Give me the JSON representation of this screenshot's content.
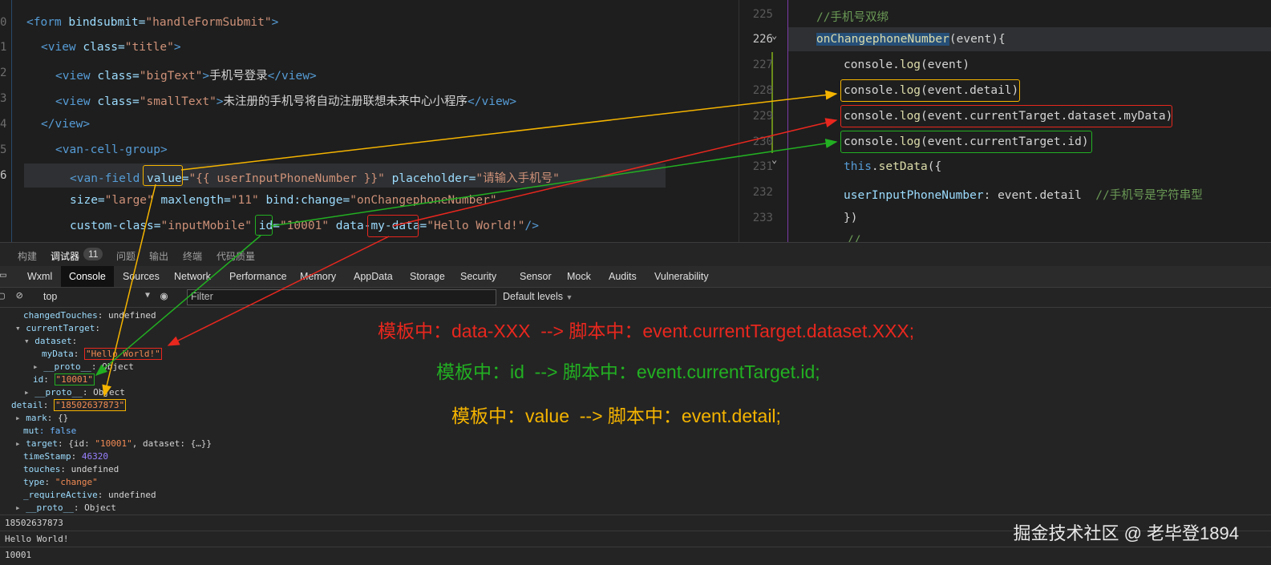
{
  "left_editor": {
    "line_numbers": [
      "0",
      "1",
      "2",
      "3",
      "4",
      "5",
      "6"
    ],
    "lines": {
      "l1_tag_open": "<form",
      "l1_attr": " bindsubmit=",
      "l1_val": "\"handleFormSubmit\"",
      "l1_close": ">",
      "l2_tag": "<view",
      "l2_attr": " class=",
      "l2_val": "\"title\"",
      "l2_close": ">",
      "l3_tag": "<view",
      "l3_attr": " class=",
      "l3_val": "\"bigText\"",
      "l3_close": ">",
      "l3_text": "手机号登录",
      "l3_end": "</view>",
      "l4_tag": "<view",
      "l4_attr": " class=",
      "l4_val": "\"smallText\"",
      "l4_close": ">",
      "l4_text": "未注册的手机号将自动注册联想未来中心小程序",
      "l4_end": "</view>",
      "l5": "</view>",
      "l6_tag": "<van-cell-group>",
      "l7_tag": "<van-field",
      "l7_attr1": "value",
      "l7_eq1": "=",
      "l7_val1": "\"{{ userInputPhoneNumber }}\"",
      "l7_attr2": " placeholder=",
      "l7_val2": "\"请输入手机号\"",
      "l8_attr1": "size=",
      "l8_val1": "\"large\"",
      "l8_attr2": " maxlength=",
      "l8_val2": "\"11\"",
      "l8_attr3": " bind:change=",
      "l8_val3": "\"onChangephoneNumber\"",
      "l9_attr1": "custom-class=",
      "l9_val1": "\"inputMobile\"",
      "l9_attr2": "id",
      "l9_eq2": "=",
      "l9_val2": "\"10001\"",
      "l9_attr3a": " data-",
      "l9_attr3b": "my-data",
      "l9_eq3": "=",
      "l9_val3": "\"Hello World!\"",
      "l9_close": "/>"
    }
  },
  "right_editor": {
    "line_numbers": [
      "225",
      "226",
      "227",
      "228",
      "229",
      "230",
      "231",
      "232",
      "233"
    ],
    "lines": {
      "r1": "//手机号双绑",
      "r2_fn": "onChangephoneNumber",
      "r2_rest": "(event){",
      "r3_a": "console.",
      "r3_fn": "log",
      "r3_b": "(event)",
      "r4_a": "console.",
      "r4_fn": "log",
      "r4_b": "(event.detail)",
      "r5_a": "console.",
      "r5_fn": "log",
      "r5_b": "(event.currentTarget.dataset.myData)",
      "r6_a": "console.",
      "r6_fn": "log",
      "r6_b": "(event.currentTarget.id)",
      "r7_kw": "this",
      "r7_b": ".",
      "r7_fn": "setData",
      "r7_c": "({",
      "r8_key": "userInputPhoneNumber",
      "r8_b": ": event.detail  ",
      "r8_cmt": "//手机号是字符串型",
      "r9": "})",
      "r10": "//"
    }
  },
  "panel_tabs": [
    "构建",
    "调试器",
    "11",
    "问题",
    "输出",
    "终端",
    "代码质量"
  ],
  "dev_tabs": [
    "Wxml",
    "Console",
    "Sources",
    "Network",
    "Performance",
    "Memory",
    "AppData",
    "Storage",
    "Security",
    "Sensor",
    "Mock",
    "Audits",
    "Vulnerability"
  ],
  "console_bar": {
    "context": "top",
    "filter_placeholder": "Filter",
    "levels": "Default levels"
  },
  "console_rows": {
    "r1_key": "changedTouches",
    "r1_val": ": undefined",
    "r2_key": "currentTarget",
    "r2_val": ":",
    "r3_key": "dataset",
    "r3_val": ":",
    "r4_key": "myData",
    "r4_sep": ": ",
    "r4_val": "\"Hello World!\"",
    "r5_key": "__proto__",
    "r5_val": ": Object",
    "r6_key": "id",
    "r6_sep": ": ",
    "r6_val": "\"10001\"",
    "r7_key": "__proto__",
    "r7_val": ": Object",
    "r8_key": "detail",
    "r8_sep": ": ",
    "r8_val": "\"18502637873\"",
    "r9_key": "mark",
    "r9_val": ": {}",
    "r10_key": "mut",
    "r10_val": ": false",
    "r11_key": "target",
    "r11_a": ": {id: ",
    "r11_str": "\"10001\"",
    "r11_b": ", dataset: {…}}",
    "r12_key": "timeStamp",
    "r12_sep": ": ",
    "r12_val": "46320",
    "r13_key": "touches",
    "r13_val": ": undefined",
    "r14_key": "type",
    "r14_sep": ": ",
    "r14_val": "\"change\"",
    "r15_key": "_requireActive",
    "r15_val": ": undefined",
    "r16_key": "__proto__",
    "r16_val": ": Object",
    "out1": "18502637873",
    "out2": "Hello World!",
    "out3": "10001"
  },
  "annotations": {
    "red": "模板中：data-XXX  --> 脚本中：event.currentTarget.dataset.XXX;",
    "green": "模板中：id  --> 脚本中：event.currentTarget.id;",
    "yellow": "模板中：value  --> 脚本中：event.detail;"
  },
  "watermark": "掘金技术社区 @ 老毕登1894",
  "colors": {
    "red": "#e8271e",
    "green": "#22b022",
    "yellow": "#f5b400"
  }
}
